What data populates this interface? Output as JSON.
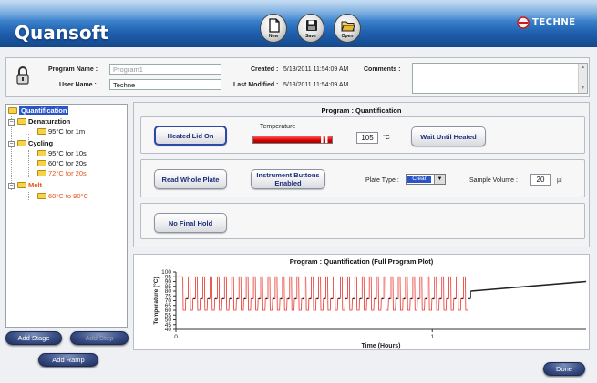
{
  "header": {
    "app_title": "Quansoft",
    "brand": "TECHNE",
    "toolbar": [
      {
        "label": "New",
        "icon": "new-document-icon"
      },
      {
        "label": "Save",
        "icon": "floppy-disk-icon"
      },
      {
        "label": "Open",
        "icon": "open-folder-icon"
      }
    ]
  },
  "info": {
    "program_name_label": "Program Name :",
    "program_name_value": "Program1",
    "user_name_label": "User Name :",
    "user_name_value": "Techne",
    "created_label": "Created :",
    "created_value": "5/13/2011 11:54:09 AM",
    "comments_label": "Comments :",
    "last_modified_label": "Last Modified :",
    "last_modified_value": "5/13/2011 11:54:09 AM"
  },
  "tree": {
    "root": "Quantification",
    "stages": [
      {
        "label": "Denaturation",
        "steps": [
          "95°C for 1m"
        ]
      },
      {
        "label": "Cycling",
        "steps": [
          "95°C for 10s",
          "60°C for 20s",
          "72°C for 20s"
        ]
      },
      {
        "label": "Melt",
        "steps": [
          "60°C to 90°C"
        ]
      }
    ]
  },
  "program": {
    "title": "Program :  Quantification",
    "heated_lid_button": "Heated Lid On",
    "temperature_label": "Temperature",
    "temperature_value": "105",
    "temperature_unit": "°C",
    "wait_until_heated_button": "Wait Until Heated",
    "read_whole_plate_button": "Read Whole Plate",
    "instrument_buttons_button_line1": "Instrument Buttons",
    "instrument_buttons_button_line2": "Enabled",
    "plate_type_label": "Plate Type :",
    "plate_type_value": "Clear",
    "sample_volume_label": "Sample Volume :",
    "sample_volume_value": "20",
    "sample_volume_unit": "µl",
    "final_hold_button": "No Final Hold"
  },
  "buttons": {
    "add_stage": "Add Stage",
    "add_step": "Add Step",
    "add_ramp": "Add Ramp",
    "done": "Done"
  },
  "chart_data": {
    "type": "line",
    "title": "Program : Quantification  (Full Program Plot)",
    "xlabel": "Time (Hours)",
    "ylabel": "Temperature (°C)",
    "xlim": [
      0,
      1.6
    ],
    "ylim": [
      40,
      100
    ],
    "x_ticks": [
      "0",
      "1"
    ],
    "y_ticks": [
      40,
      45,
      50,
      55,
      60,
      65,
      70,
      75,
      80,
      85,
      90,
      95,
      100
    ],
    "grid": false,
    "legend": "none",
    "series": [
      {
        "color": "#e8322b",
        "segments": [
          {
            "kind": "hold",
            "x": [
              0,
              0.02
            ],
            "y": 95
          },
          {
            "kind": "cycles",
            "x_start": 0.02,
            "x_end": 1.15,
            "cycles": 40,
            "levels": [
              95,
              60,
              72
            ]
          }
        ]
      },
      {
        "color": "#222222",
        "segments": [
          {
            "kind": "melt",
            "x": [
              1.15,
              1.6
            ],
            "y": [
              80,
              90
            ]
          }
        ]
      }
    ]
  }
}
